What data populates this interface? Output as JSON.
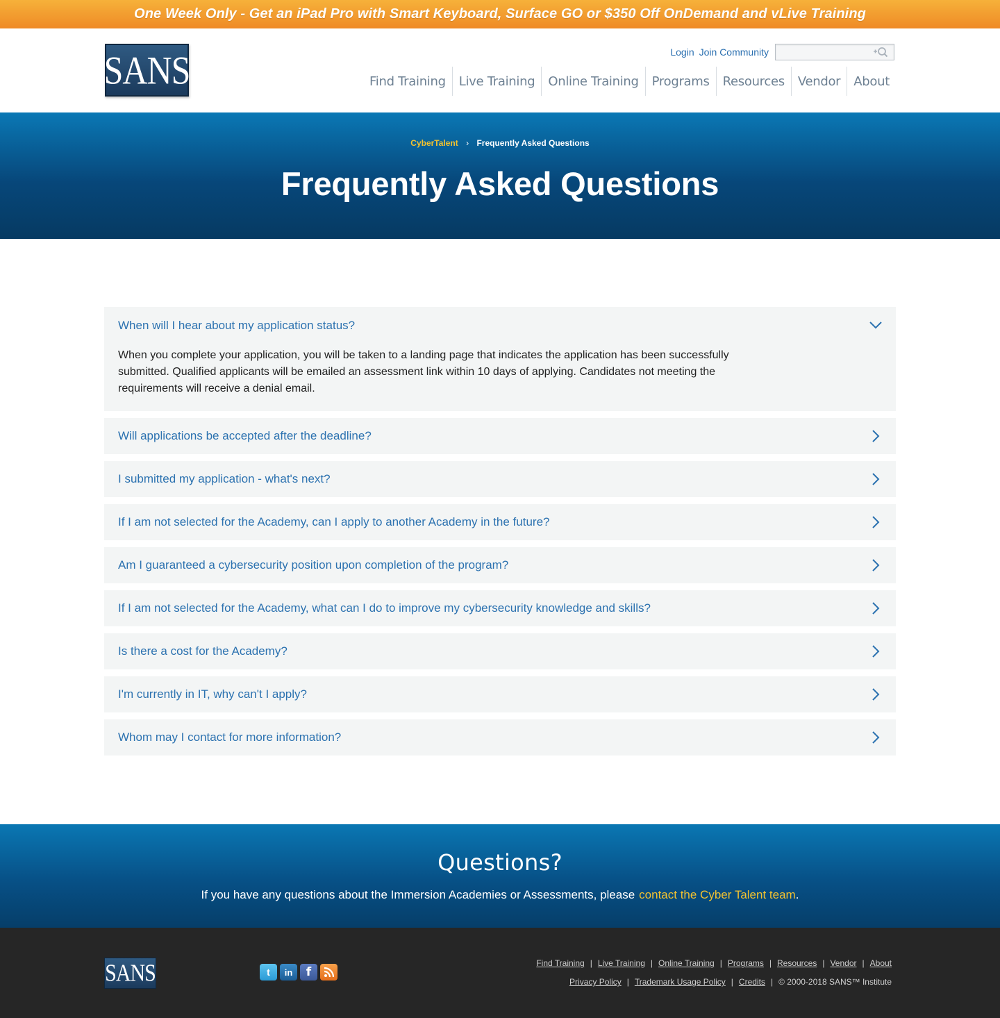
{
  "promo": {
    "text": "One Week Only - Get an iPad Pro with Smart Keyboard, Surface GO or $350 Off OnDemand and vLive Training"
  },
  "header": {
    "logo_text": "SANS",
    "login": "Login",
    "join": "Join Community",
    "search_placeholder": "",
    "nav": [
      "Find Training",
      "Live Training",
      "Online Training",
      "Programs",
      "Resources",
      "Vendor",
      "About"
    ]
  },
  "hero": {
    "breadcrumb_link": "CyberTalent",
    "breadcrumb_sep": "›",
    "breadcrumb_current": "Frequently Asked Questions",
    "title": "Frequently Asked Questions"
  },
  "faq": {
    "items": [
      {
        "q": "When will I hear about my application status?",
        "a": "When you complete your application, you will be taken to a landing page that indicates the application has been successfully submitted. Qualified applicants will be emailed an assessment link within 10 days of applying. Candidates not meeting the requirements will receive a denial email."
      },
      {
        "q": "Will applications be accepted after the deadline?"
      },
      {
        "q": "I submitted my application - what's next?"
      },
      {
        "q": "If I am not selected for the Academy, can I apply to another Academy in the future?"
      },
      {
        "q": "Am I guaranteed a cybersecurity position upon completion of the program?"
      },
      {
        "q": "If I am not selected for the Academy, what can I do to improve my cybersecurity knowledge and skills?"
      },
      {
        "q": "Is there a cost for the Academy?"
      },
      {
        "q": "I'm currently in IT, why can't I apply?"
      },
      {
        "q": "Whom may I contact for more information?"
      }
    ]
  },
  "questions": {
    "title": "Questions?",
    "text": "If you have any questions about the Immersion Academies or Assessments, please",
    "link": "contact the Cyber Talent team",
    "end": "."
  },
  "footer": {
    "logo_text": "SANS",
    "social": {
      "twitter": "t",
      "linkedin": "in",
      "facebook": "f",
      "rss": "rss-icon"
    },
    "links": [
      "Find Training",
      "Live Training",
      "Online Training",
      "Programs",
      "Resources",
      "Vendor",
      "About"
    ],
    "links2": [
      "Privacy Policy",
      "Trademark Usage Policy",
      "Credits"
    ],
    "copyright": "© 2000-2018 SANS™ Institute"
  },
  "colors": {
    "accent_link": "#2c72b0",
    "highlight": "#f2c230",
    "hero_top": "#0a78b5",
    "hero_bottom": "#063a62"
  }
}
